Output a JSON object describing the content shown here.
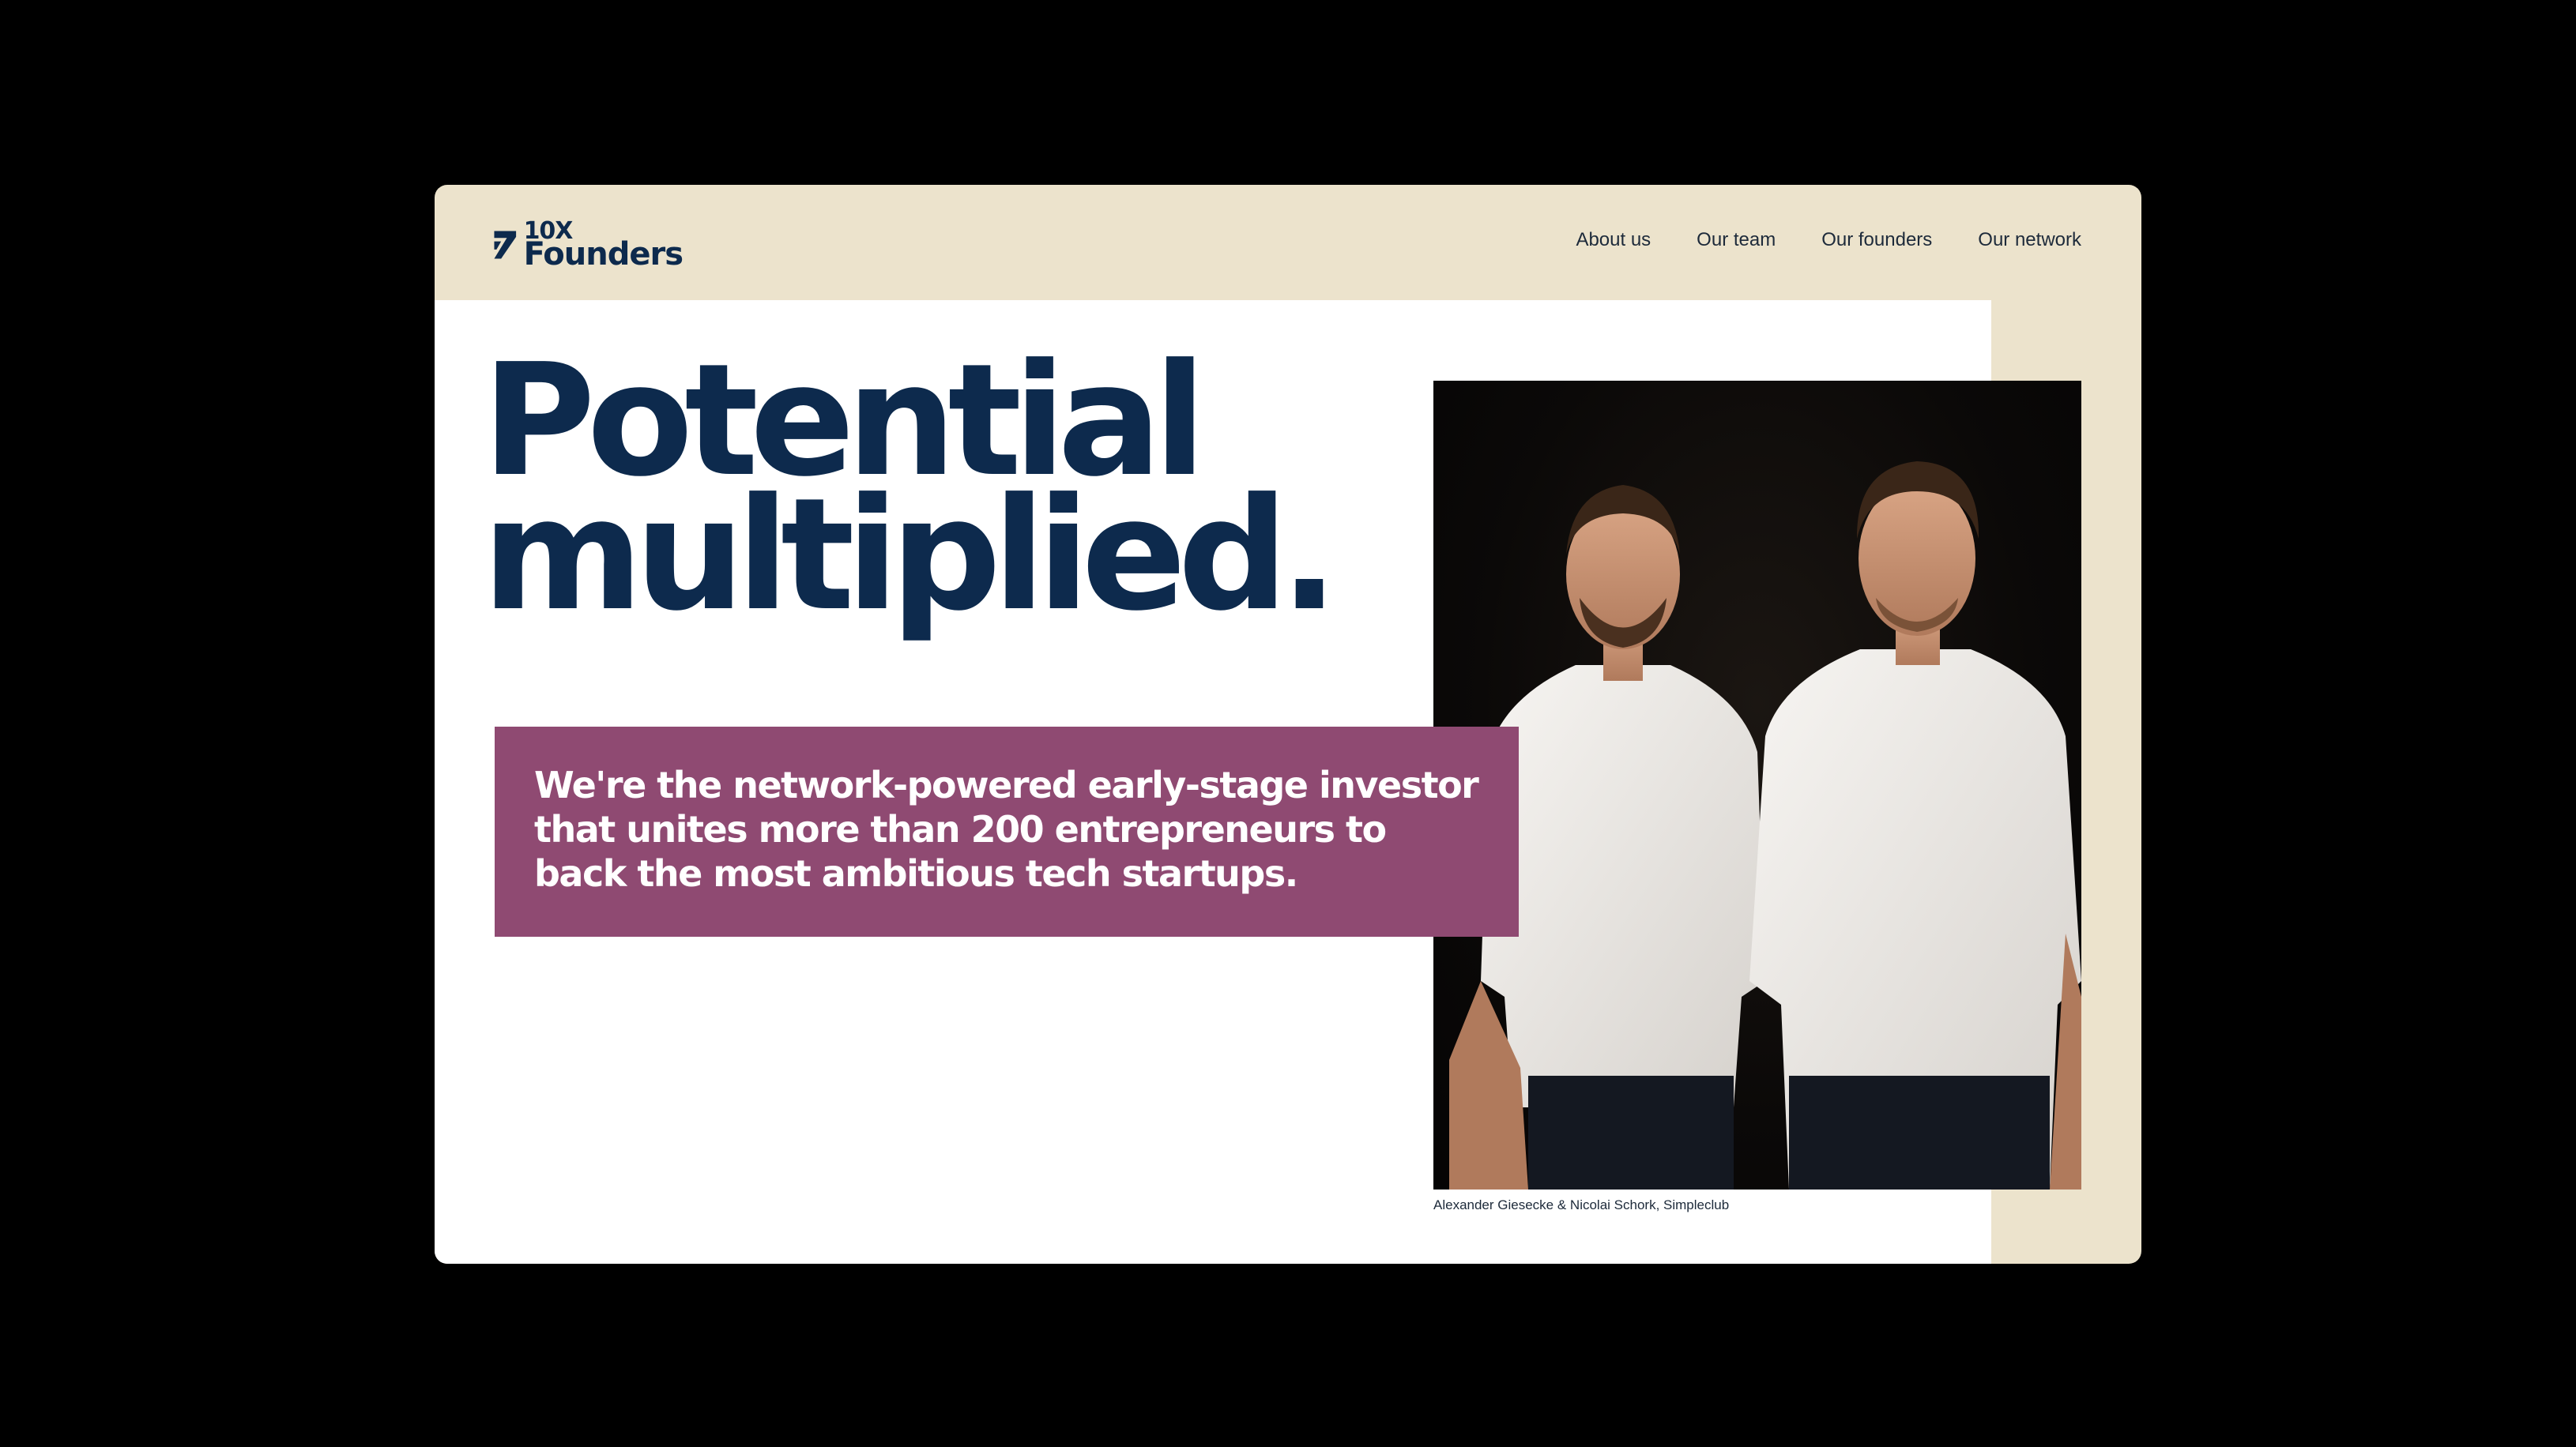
{
  "brand": {
    "logo_line1": "10X",
    "logo_line2": "Founders",
    "color_primary": "#0d2a4d",
    "color_accent": "#8f4a72",
    "color_background": "#ece3cc"
  },
  "nav": {
    "items": [
      {
        "label": "About us"
      },
      {
        "label": "Our team"
      },
      {
        "label": "Our founders"
      },
      {
        "label": "Our network"
      }
    ]
  },
  "hero": {
    "headline_line1": "Potential",
    "headline_line2": "multiplied.",
    "tagline": "We're the network-powered early-stage investor that unites more than 200 entrepreneurs to back the most ambitious tech startups.",
    "photo_caption": "Alexander Giesecke & Nicolai Schork, Simpleclub"
  }
}
